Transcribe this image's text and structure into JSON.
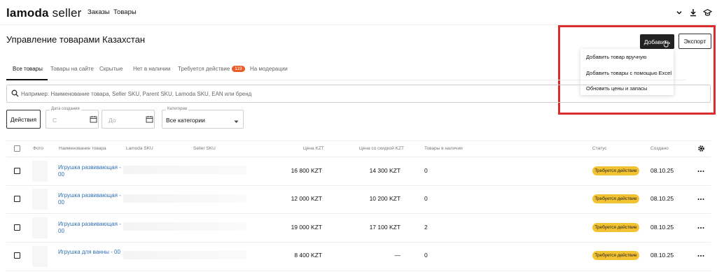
{
  "nav": {
    "logo_brand": "lamoda",
    "logo_suffix": "seller",
    "links": [
      "Заказы",
      "Товары"
    ]
  },
  "header": {
    "title": "Управление товарами Казахстан",
    "add_button": "Добавить",
    "export_button": "Экспорт"
  },
  "add_menu": {
    "items": [
      "Добавить товар вручную",
      "Добавить товары с помощью Excel",
      "Обновить цены и запасы"
    ]
  },
  "tabs": [
    {
      "label": "Все товары"
    },
    {
      "label": "Товары на сайте"
    },
    {
      "label": "Скрытые"
    },
    {
      "label": "Нет в наличии"
    },
    {
      "label": "Требуется действие",
      "badge": "119"
    },
    {
      "label": "На модерации"
    }
  ],
  "search": {
    "placeholder": "Например: Наименование товара, Seller SKU, Parent SKU, Lamoda SKU, EAN или бренд"
  },
  "filters": {
    "actions_button": "Действия",
    "date_label": "Дата создания",
    "date_from": "С",
    "date_to": "До",
    "category_label": "Категории",
    "category_value": "Все категории"
  },
  "table": {
    "columns": [
      "Фото",
      "Наименование товара",
      "Lamoda SKU",
      "Seller SKU",
      "Цена KZT",
      "Цена со скидкой KZT",
      "Товары в наличии",
      "Статус",
      "Создано"
    ],
    "rows": [
      {
        "name": "Игрушка развивающая - 00",
        "price": "16 800 KZT",
        "discount_price": "14 300 KZT",
        "stock": "0",
        "status": "Требуется действие",
        "created": "08.10.25"
      },
      {
        "name": "Игрушка развивающая - 00",
        "price": "12 000 KZT",
        "discount_price": "10 200 KZT",
        "stock": "0",
        "status": "Требуется действие",
        "created": "08.10.25"
      },
      {
        "name": "Игрушка развивающая - 00",
        "price": "19 000 KZT",
        "discount_price": "17 100 KZT",
        "stock": "2",
        "status": "Требуется действие",
        "created": "08.10.25"
      },
      {
        "name": "Игрушка для ванны - 00",
        "price": "8 400 KZT",
        "discount_price": "—",
        "stock": "0",
        "status": "Требуется действие",
        "created": "08.10.25"
      }
    ]
  },
  "colors": {
    "accent_link": "#2f6fb3",
    "status_badge": "#f2c233",
    "tab_badge": "#e85d2a",
    "highlight_box": "#d92e2e"
  }
}
